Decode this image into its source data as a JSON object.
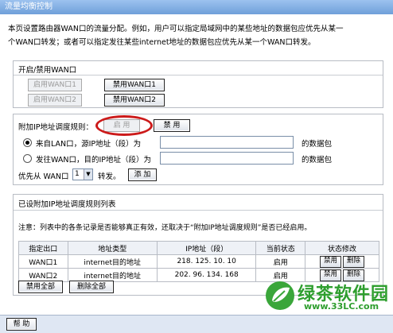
{
  "window": {
    "title": "流量均衡控制"
  },
  "description": {
    "line1": "本页设置路由器WAN口的流量分配。例如，用户可以指定局域网中的某些地址的数据包应优先从某一",
    "line2": "个WAN口转发；或者可以指定发往某些internet地址的数据包应优先从某一个WAN口转发。"
  },
  "wan_toggle": {
    "title": "开启/禁用WAN口",
    "enable_wan1": "启用WAN口1",
    "disable_wan1": "禁用WAN口1",
    "enable_wan2": "启用WAN口2",
    "disable_wan2": "禁用WAN口2"
  },
  "rule_config": {
    "label": "附加IP地址调度规则：",
    "enable_label": "启 用",
    "disable_label": "禁 用",
    "option_lan": "来自LAN口，源IP地址（段）为",
    "option_wan": "发往WAN口，目的IP地址（段）为",
    "packet_suffix_1": "的数据包",
    "packet_suffix_2": "的数据包",
    "source_ip_value": "",
    "dest_ip_value": "",
    "priority_prefix": "优先从 WAN口",
    "priority_value": "1",
    "priority_suffix": "转发。",
    "add_label": "添 加"
  },
  "rule_list": {
    "title": "已设附加IP地址调度规则列表",
    "note": "注意：列表中的各条记录是否能够真正有效，还取决于“附加IP地址调度规则”是否已经启用。",
    "headers": [
      "指定出口",
      "地址类型",
      "IP地址（段）",
      "当前状态",
      "状态修改"
    ],
    "rows": [
      {
        "port": "WAN口1",
        "type": "internet目的地址",
        "ip": "218. 125. 10. 10",
        "status": "启用",
        "disable": "禁用",
        "delete": "删除"
      },
      {
        "port": "WAN口2",
        "type": "internet目的地址",
        "ip": "202. 96. 134. 168",
        "status": "启用",
        "disable": "禁用",
        "delete": "删除"
      }
    ],
    "disable_all": "禁用全部",
    "delete_all": "删除全部"
  },
  "footer": {
    "help": "帮 助"
  },
  "watermark": {
    "name": "绿茶软件园",
    "url": "www.33LC.com",
    "color": "#2e9e2e"
  },
  "colors": {
    "highlight_circle": "#cc1a1a",
    "titlebar": "#6f9fd9"
  }
}
